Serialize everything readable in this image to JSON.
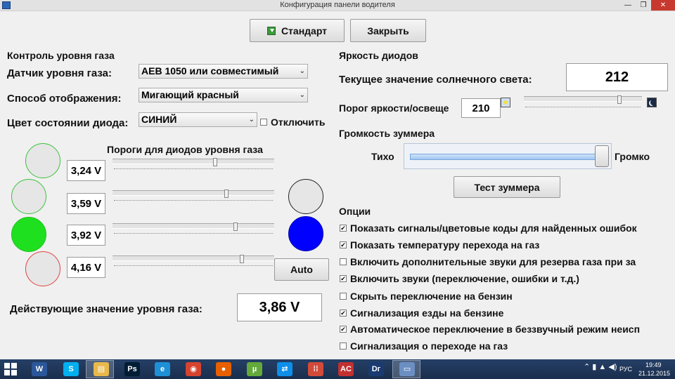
{
  "window": {
    "title": "Конфигурация панели водителя",
    "min_glyph": "—",
    "max_glyph": "❐",
    "close_glyph": "✕"
  },
  "toolbar": {
    "standard_label": "Стандарт",
    "close_label": "Закрыть"
  },
  "gas": {
    "header": "Контроль уровня газа",
    "sensor_label": "Датчик уровня газа:",
    "sensor_value": "AEB 1050 или совместимый",
    "display_label": "Способ отображения:",
    "display_value": "Мигающий красный",
    "led_color_label": "Цвет состоянии диода:",
    "led_color_value": "СИНИЙ",
    "disable_label": "Отключить",
    "disable_checked": false,
    "thresholds_header": "Пороги для диодов уровня газа",
    "thresholds": [
      {
        "value": "3,24 V",
        "slider_level": 0.64,
        "led_color": "#e6e6e6",
        "led_border": "#3cc23c"
      },
      {
        "value": "3,59 V",
        "slider_level": 0.71,
        "led_color": "#e6e6e6",
        "led_border": "#3cc23c"
      },
      {
        "value": "3,92 V",
        "slider_level": 0.77,
        "led_color": "#1fe01f",
        "led_border": "#1fc21f"
      },
      {
        "value": "4,16 V",
        "slider_level": 0.81,
        "led_color": "#e6e6e6",
        "led_border": "#e04545"
      }
    ],
    "right_leds": [
      {
        "color": "#e6e6e6",
        "border": "#222222"
      },
      {
        "color": "#0000ff",
        "border": "#0000aa"
      }
    ],
    "auto_label": "Auto",
    "current_label": "Действующие значение уровня газа:",
    "current_value": "3,86 V"
  },
  "brightness": {
    "header": "Яркость диодов",
    "sun_label": "Текущее значение солнечного света:",
    "sun_value": "212",
    "threshold_label": "Порог яркости/освеще",
    "threshold_value": "210",
    "slider_level": 0.82
  },
  "buzzer": {
    "header": "Громкость зуммера",
    "quiet_label": "Тихо",
    "loud_label": "Громко",
    "level": 1.0,
    "test_label": "Тест зуммера"
  },
  "options": {
    "header": "Опции",
    "items": [
      {
        "label": "Показать сигналы/цветовые коды для найденных ошибок",
        "checked": true
      },
      {
        "label": "Показать температуру перехода на газ",
        "checked": true
      },
      {
        "label": "Включить дополнительные звуки для резерва газа при за",
        "checked": false
      },
      {
        "label": "Включить звуки (переключение, ошибки и т.д.)",
        "checked": true
      },
      {
        "label": "Скрыть переключение на бензин",
        "checked": false
      },
      {
        "label": "Сигнализация езды на бензине",
        "checked": true
      },
      {
        "label": "Автоматическое переключение в беззвучный режим неисп",
        "checked": true
      },
      {
        "label": "Сигнализация о переходе на газ",
        "checked": false
      }
    ]
  },
  "taskbar": {
    "apps": [
      {
        "name": "word-icon",
        "glyph": "W",
        "color": "#2b579a"
      },
      {
        "name": "skype-icon",
        "glyph": "S",
        "color": "#00aff0"
      },
      {
        "name": "explorer-icon",
        "glyph": "▤",
        "color": "#e8b84a"
      },
      {
        "name": "photoshop-icon",
        "glyph": "Ps",
        "color": "#001d34"
      },
      {
        "name": "ie-icon",
        "glyph": "e",
        "color": "#1e90d6"
      },
      {
        "name": "chrome-icon",
        "glyph": "◉",
        "color": "#d6432f"
      },
      {
        "name": "firefox-icon",
        "glyph": "●",
        "color": "#e66000"
      },
      {
        "name": "utorrent-icon",
        "glyph": "µ",
        "color": "#63a93c"
      },
      {
        "name": "teamviewer-icon",
        "glyph": "⇄",
        "color": "#0e8ee9"
      },
      {
        "name": "grid-app-icon",
        "glyph": "⁞⁞",
        "color": "#d24a3a"
      },
      {
        "name": "ac-app-icon",
        "glyph": "AC",
        "color": "#c23030"
      },
      {
        "name": "dg-app-icon",
        "glyph": "Dг",
        "color": "#1a3a70"
      },
      {
        "name": "panel-config-app-icon",
        "glyph": "▭",
        "color": "#6b8fc2"
      }
    ],
    "lang": "РУС",
    "time": "19:49",
    "date": "21.12.2015"
  }
}
